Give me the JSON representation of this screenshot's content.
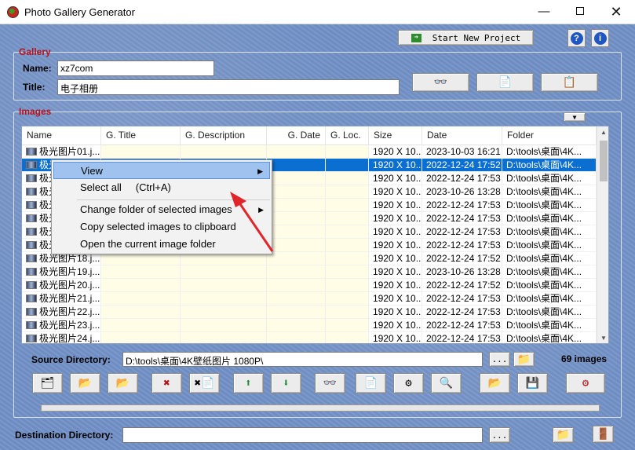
{
  "window": {
    "title": "Photo Gallery Generator",
    "min": "—",
    "close": "✕"
  },
  "header": {
    "start_new_project": "Start New Project"
  },
  "gallery": {
    "label": "Gallery",
    "name_label": "Name:",
    "name_value": "xz7com",
    "title_label": "Title:",
    "title_value": "电子相册"
  },
  "images": {
    "label": "Images",
    "columns": [
      "Name",
      "G. Title",
      "G. Description",
      "G. Date",
      "G. Loc.",
      "Size",
      "Date",
      "Folder"
    ],
    "rows": [
      {
        "name": "极光图片01.j...",
        "size": "1920 X 10...",
        "date": "2023-10-03 16:21",
        "folder": "D:\\tools\\桌面\\4K..."
      },
      {
        "name": "极光图片02.j...",
        "size": "1920 X 10...",
        "date": "2022-12-24 17:52",
        "folder": "D:\\tools\\桌面\\4K..."
      },
      {
        "name": "极光图片03.j...",
        "size": "1920 X 10...",
        "date": "2022-12-24 17:53",
        "folder": "D:\\tools\\桌面\\4K..."
      },
      {
        "name": "极光图片04.j...",
        "size": "1920 X 10...",
        "date": "2023-10-26 13:28",
        "folder": "D:\\tools\\桌面\\4K..."
      },
      {
        "name": "极光图片05.j...",
        "size": "1920 X 10...",
        "date": "2022-12-24 17:53",
        "folder": "D:\\tools\\桌面\\4K..."
      },
      {
        "name": "极光图片06.j...",
        "size": "1920 X 10...",
        "date": "2022-12-24 17:53",
        "folder": "D:\\tools\\桌面\\4K..."
      },
      {
        "name": "极光图片07.j...",
        "size": "1920 X 10...",
        "date": "2022-12-24 17:53",
        "folder": "D:\\tools\\桌面\\4K..."
      },
      {
        "name": "极光图片08.j...",
        "size": "1920 X 10...",
        "date": "2022-12-24 17:53",
        "folder": "D:\\tools\\桌面\\4K..."
      },
      {
        "name": "极光图片18.j...",
        "size": "1920 X 10...",
        "date": "2022-12-24 17:52",
        "folder": "D:\\tools\\桌面\\4K..."
      },
      {
        "name": "极光图片19.j...",
        "size": "1920 X 10...",
        "date": "2023-10-26 13:28",
        "folder": "D:\\tools\\桌面\\4K..."
      },
      {
        "name": "极光图片20.j...",
        "size": "1920 X 10...",
        "date": "2022-12-24 17:52",
        "folder": "D:\\tools\\桌面\\4K..."
      },
      {
        "name": "极光图片21.j...",
        "size": "1920 X 10...",
        "date": "2022-12-24 17:53",
        "folder": "D:\\tools\\桌面\\4K..."
      },
      {
        "name": "极光图片22.j...",
        "size": "1920 X 10...",
        "date": "2022-12-24 17:53",
        "folder": "D:\\tools\\桌面\\4K..."
      },
      {
        "name": "极光图片23.j...",
        "size": "1920 X 10...",
        "date": "2022-12-24 17:53",
        "folder": "D:\\tools\\桌面\\4K..."
      },
      {
        "name": "极光图片24.j...",
        "size": "1920 X 10...",
        "date": "2022-12-24 17:53",
        "folder": "D:\\tools\\桌面\\4K..."
      }
    ],
    "selected_index": 1
  },
  "context_menu": {
    "view": "View",
    "select_all": "Select all",
    "select_all_accel": "(Ctrl+A)",
    "change_folder": "Change folder of selected images",
    "copy_clipboard": "Copy selected images to clipboard",
    "open_folder": "Open the current image folder"
  },
  "source": {
    "label": "Source Directory:",
    "value": "D:\\tools\\桌面\\4K壁纸图片 1080P\\",
    "browse": "...",
    "count": "69 images"
  },
  "destination": {
    "label": "Destination Directory:",
    "value": "",
    "browse": "..."
  },
  "colors": {
    "accent_red": "#b5121b",
    "selection_blue": "#0a6fd1",
    "background": "#7392c8"
  }
}
